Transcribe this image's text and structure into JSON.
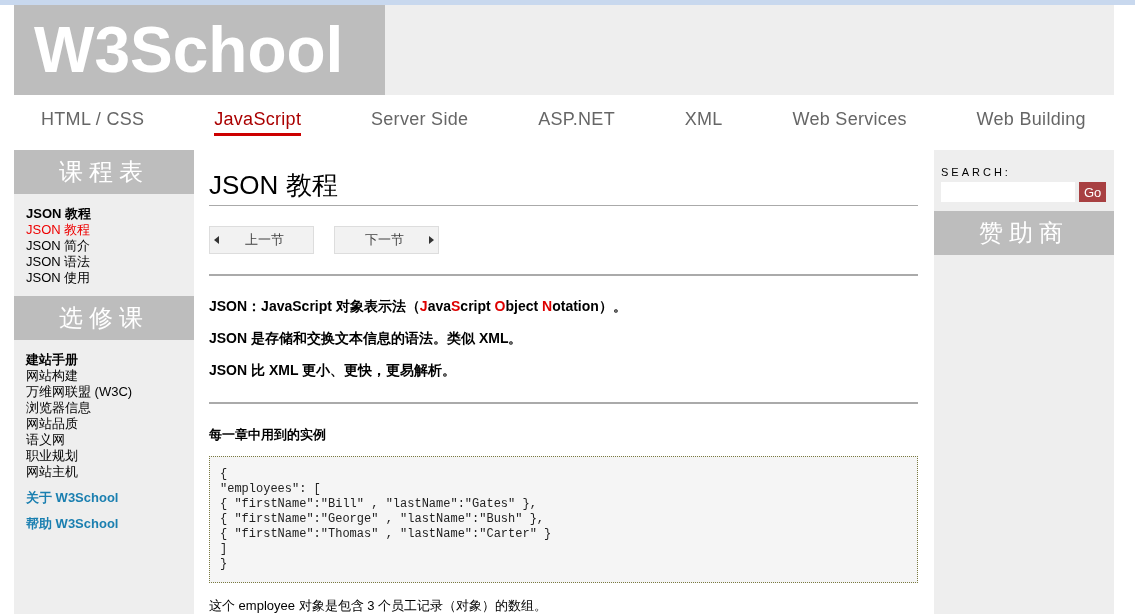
{
  "logo": "W3School",
  "nav": [
    {
      "label": "HTML / CSS",
      "selected": false
    },
    {
      "label": "JavaScript",
      "selected": true
    },
    {
      "label": "Server Side",
      "selected": false
    },
    {
      "label": "ASP.NET",
      "selected": false
    },
    {
      "label": "XML",
      "selected": false
    },
    {
      "label": "Web Services",
      "selected": false
    },
    {
      "label": "Web Building",
      "selected": false
    }
  ],
  "sidebar": [
    {
      "title": "课程表",
      "items": [
        {
          "label": "JSON 教程",
          "kind": "heading",
          "selected": false
        },
        {
          "label": "JSON 教程",
          "kind": "item",
          "selected": true
        },
        {
          "label": "JSON 简介",
          "kind": "item",
          "selected": false
        },
        {
          "label": "JSON 语法",
          "kind": "item",
          "selected": false
        },
        {
          "label": "JSON 使用",
          "kind": "item",
          "selected": false
        }
      ]
    },
    {
      "title": "选修课",
      "items": [
        {
          "label": "建站手册",
          "kind": "heading",
          "selected": false
        },
        {
          "label": "网站构建",
          "kind": "item",
          "selected": false
        },
        {
          "label": "万维网联盟 (W3C)",
          "kind": "item",
          "selected": false
        },
        {
          "label": "浏览器信息",
          "kind": "item",
          "selected": false
        },
        {
          "label": "网站品质",
          "kind": "item",
          "selected": false
        },
        {
          "label": "语义网",
          "kind": "item",
          "selected": false
        },
        {
          "label": "职业规划",
          "kind": "item",
          "selected": false
        },
        {
          "label": "网站主机",
          "kind": "item",
          "selected": false
        },
        {
          "label": "关于 W3School",
          "kind": "link",
          "selected": false
        },
        {
          "label": "帮助 W3School",
          "kind": "link",
          "selected": false
        }
      ]
    }
  ],
  "main": {
    "title": "JSON 教程",
    "prev": "上一节",
    "next": "下一节",
    "intro": [
      {
        "text": "JSON：JavaScript 对象表示法（",
        "red": false
      },
      {
        "text": "J",
        "red": true
      },
      {
        "text": "ava",
        "red": false
      },
      {
        "text": "S",
        "red": true
      },
      {
        "text": "cript ",
        "red": false
      },
      {
        "text": "O",
        "red": true
      },
      {
        "text": "bject ",
        "red": false
      },
      {
        "text": "N",
        "red": true
      },
      {
        "text": "otation）。",
        "red": false
      }
    ],
    "points": [
      "JSON 是存储和交换文本信息的语法。类似 XML。",
      "JSON 比 XML 更小、更快，更易解析。"
    ],
    "example_heading": "每一章中用到的实例",
    "code": "{\n\"employees\": [\n{ \"firstName\":\"Bill\" , \"lastName\":\"Gates\" },\n{ \"firstName\":\"George\" , \"lastName\":\"Bush\" },\n{ \"firstName\":\"Thomas\" , \"lastName\":\"Carter\" }\n]\n}",
    "note": "这个 employee 对象是包含 3 个员工记录（对象）的数组。"
  },
  "right": {
    "search_label": "SEARCH:",
    "go": "Go",
    "sponsor_title": "赞助商"
  }
}
